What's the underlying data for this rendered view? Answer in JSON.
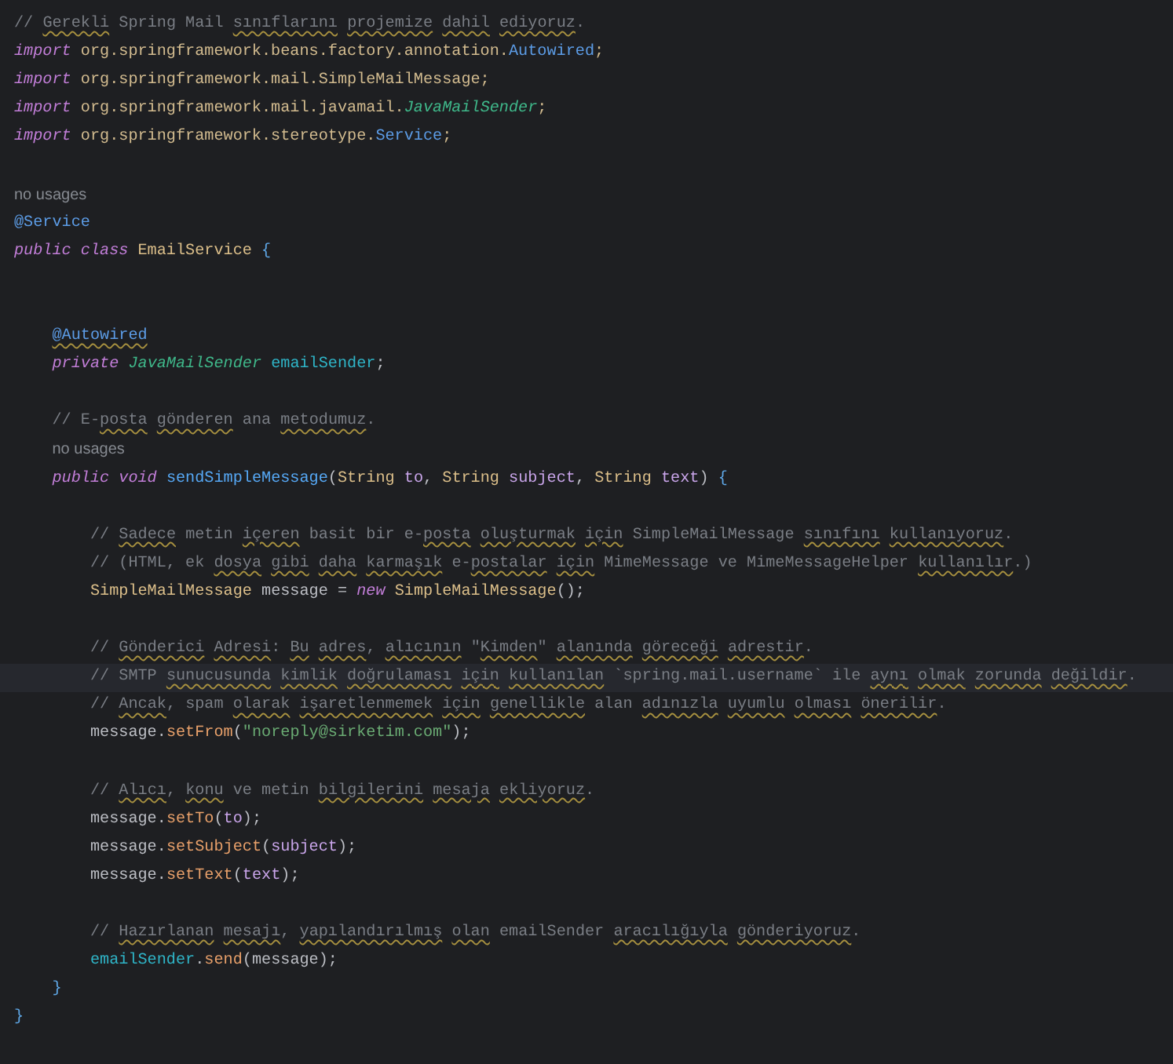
{
  "editor": {
    "lines": [
      {
        "kind": "code",
        "current": false,
        "tokens": [
          {
            "kind": "comment",
            "text": "// ",
            "typo": false
          },
          {
            "kind": "comment",
            "text": "Gerekli",
            "typo": true
          },
          {
            "kind": "comment",
            "text": " Spring Mail ",
            "typo": false
          },
          {
            "kind": "comment",
            "text": "sınıflarını ",
            "typo": true
          },
          {
            "kind": "comment",
            "text": "projemize ",
            "typo": true
          },
          {
            "kind": "comment",
            "text": "dahil ",
            "typo": true
          },
          {
            "kind": "comment",
            "text": "ediyoruz",
            "typo": true
          },
          {
            "kind": "comment",
            "text": ".",
            "typo": false
          }
        ]
      },
      {
        "kind": "code",
        "current": false,
        "tokens": [
          {
            "kind": "keyword",
            "text": "import"
          },
          {
            "kind": "package",
            "text": " org.springframework.beans.factory.annotation."
          },
          {
            "kind": "annotation",
            "text": "Autowired"
          },
          {
            "kind": "package",
            "text": ";"
          }
        ]
      },
      {
        "kind": "code",
        "current": false,
        "tokens": [
          {
            "kind": "keyword",
            "text": "import"
          },
          {
            "kind": "package",
            "text": " org.springframework.mail.SimpleMailMessage;"
          }
        ]
      },
      {
        "kind": "code",
        "current": false,
        "tokens": [
          {
            "kind": "keyword",
            "text": "import"
          },
          {
            "kind": "package",
            "text": " org.springframework.mail.javamail."
          },
          {
            "kind": "interface",
            "text": "JavaMailSender"
          },
          {
            "kind": "package",
            "text": ";"
          }
        ]
      },
      {
        "kind": "code",
        "current": false,
        "tokens": [
          {
            "kind": "keyword",
            "text": "import"
          },
          {
            "kind": "package",
            "text": " org.springframework.stereotype."
          },
          {
            "kind": "annotation",
            "text": "Service"
          },
          {
            "kind": "package",
            "text": ";"
          }
        ]
      },
      {
        "kind": "blank",
        "current": false
      },
      {
        "kind": "hint",
        "current": false,
        "tokens": [
          {
            "kind": "hint",
            "text": "no usages"
          }
        ]
      },
      {
        "kind": "code",
        "current": false,
        "tokens": [
          {
            "kind": "annotation",
            "text": "@Service"
          }
        ]
      },
      {
        "kind": "code",
        "current": false,
        "tokens": [
          {
            "kind": "keyword",
            "text": "public class"
          },
          {
            "kind": "type",
            "text": " EmailService "
          },
          {
            "kind": "brace",
            "text": "{"
          }
        ]
      },
      {
        "kind": "blank",
        "current": false
      },
      {
        "kind": "blank",
        "current": false
      },
      {
        "kind": "code",
        "current": false,
        "tokens": [
          {
            "kind": "annotation",
            "text": "    @Autowired",
            "typo": true
          }
        ]
      },
      {
        "kind": "code",
        "current": false,
        "tokens": [
          {
            "kind": "keyword",
            "text": "    private "
          },
          {
            "kind": "interface",
            "text": "JavaMailSender "
          },
          {
            "kind": "field",
            "text": "emailSender"
          },
          {
            "kind": "plain",
            "text": ";"
          }
        ]
      },
      {
        "kind": "blank",
        "current": false
      },
      {
        "kind": "code",
        "current": false,
        "tokens": [
          {
            "kind": "comment",
            "text": "    // E-",
            "typo": false
          },
          {
            "kind": "comment",
            "text": "posta ",
            "typo": true
          },
          {
            "kind": "comment",
            "text": "gönderen",
            "typo": true
          },
          {
            "kind": "comment",
            "text": " ana ",
            "typo": false
          },
          {
            "kind": "comment",
            "text": "metodumuz",
            "typo": true
          },
          {
            "kind": "comment",
            "text": ".",
            "typo": false
          }
        ]
      },
      {
        "kind": "hint",
        "current": false,
        "tokens": [
          {
            "kind": "hint",
            "text": "    no usages"
          }
        ]
      },
      {
        "kind": "code",
        "current": false,
        "tokens": [
          {
            "kind": "keyword",
            "text": "    public void "
          },
          {
            "kind": "method",
            "text": "sendSimpleMessage"
          },
          {
            "kind": "plain",
            "text": "("
          },
          {
            "kind": "type",
            "text": "String "
          },
          {
            "kind": "param",
            "text": "to"
          },
          {
            "kind": "plain",
            "text": ", "
          },
          {
            "kind": "type",
            "text": "String "
          },
          {
            "kind": "param",
            "text": "subject"
          },
          {
            "kind": "plain",
            "text": ", "
          },
          {
            "kind": "type",
            "text": "String "
          },
          {
            "kind": "param",
            "text": "text"
          },
          {
            "kind": "plain",
            "text": ") "
          },
          {
            "kind": "brace",
            "text": "{"
          }
        ]
      },
      {
        "kind": "blank",
        "current": false
      },
      {
        "kind": "code",
        "current": false,
        "tokens": [
          {
            "kind": "comment",
            "text": "        // ",
            "typo": false
          },
          {
            "kind": "comment",
            "text": "Sadece",
            "typo": true
          },
          {
            "kind": "comment",
            "text": " metin ",
            "typo": false
          },
          {
            "kind": "comment",
            "text": "içeren",
            "typo": true
          },
          {
            "kind": "comment",
            "text": " basit bir e-",
            "typo": false
          },
          {
            "kind": "comment",
            "text": "posta ",
            "typo": true
          },
          {
            "kind": "comment",
            "text": "oluşturmak ",
            "typo": true
          },
          {
            "kind": "comment",
            "text": "için",
            "typo": true
          },
          {
            "kind": "comment",
            "text": " SimpleMailMessage ",
            "typo": false
          },
          {
            "kind": "comment",
            "text": "sınıfını ",
            "typo": true
          },
          {
            "kind": "comment",
            "text": "kullanıyoruz",
            "typo": true
          },
          {
            "kind": "comment",
            "text": ".",
            "typo": false
          }
        ]
      },
      {
        "kind": "code",
        "current": false,
        "tokens": [
          {
            "kind": "comment",
            "text": "        // (HTML, ek ",
            "typo": false
          },
          {
            "kind": "comment",
            "text": "dosya ",
            "typo": true
          },
          {
            "kind": "comment",
            "text": "gibi ",
            "typo": true
          },
          {
            "kind": "comment",
            "text": "daha ",
            "typo": true
          },
          {
            "kind": "comment",
            "text": "karmaşık",
            "typo": true
          },
          {
            "kind": "comment",
            "text": " e-",
            "typo": false
          },
          {
            "kind": "comment",
            "text": "postalar ",
            "typo": true
          },
          {
            "kind": "comment",
            "text": "için",
            "typo": true
          },
          {
            "kind": "comment",
            "text": " MimeMessage ve MimeMessageHelper ",
            "typo": false
          },
          {
            "kind": "comment",
            "text": "kullanılır",
            "typo": true
          },
          {
            "kind": "comment",
            "text": ".)",
            "typo": false
          }
        ]
      },
      {
        "kind": "code",
        "current": false,
        "tokens": [
          {
            "kind": "type",
            "text": "        SimpleMailMessage"
          },
          {
            "kind": "plain",
            "text": " message = "
          },
          {
            "kind": "keyword",
            "text": "new "
          },
          {
            "kind": "type",
            "text": "SimpleMailMessage"
          },
          {
            "kind": "plain",
            "text": "();"
          }
        ]
      },
      {
        "kind": "blank",
        "current": false
      },
      {
        "kind": "code",
        "current": false,
        "tokens": [
          {
            "kind": "comment",
            "text": "        // ",
            "typo": false
          },
          {
            "kind": "comment",
            "text": "Gönderici ",
            "typo": true
          },
          {
            "kind": "comment",
            "text": "Adresi",
            "typo": true
          },
          {
            "kind": "comment",
            "text": ": ",
            "typo": false
          },
          {
            "kind": "comment",
            "text": "Bu ",
            "typo": true
          },
          {
            "kind": "comment",
            "text": "adres",
            "typo": true
          },
          {
            "kind": "comment",
            "text": ", ",
            "typo": false
          },
          {
            "kind": "comment",
            "text": "alıcının",
            "typo": true
          },
          {
            "kind": "comment",
            "text": " \"",
            "typo": false
          },
          {
            "kind": "comment",
            "text": "Kimden",
            "typo": true
          },
          {
            "kind": "comment",
            "text": "\" ",
            "typo": false
          },
          {
            "kind": "comment",
            "text": "alanında ",
            "typo": true
          },
          {
            "kind": "comment",
            "text": "göreceği ",
            "typo": true
          },
          {
            "kind": "comment",
            "text": "adrestir",
            "typo": true
          },
          {
            "kind": "comment",
            "text": ".",
            "typo": false
          }
        ]
      },
      {
        "kind": "code",
        "current": true,
        "tokens": [
          {
            "kind": "comment",
            "text": "        // SMTP ",
            "typo": false
          },
          {
            "kind": "comment",
            "text": "sunucusunda ",
            "typo": true
          },
          {
            "kind": "comment",
            "text": "kimlik ",
            "typo": true
          },
          {
            "kind": "comment",
            "text": "doğrulaması ",
            "typo": true
          },
          {
            "kind": "comment",
            "text": "için ",
            "typo": true
          },
          {
            "kind": "comment",
            "text": "kullanılan",
            "typo": true
          },
          {
            "kind": "comment",
            "text": " `spring.mail.username` ile ",
            "typo": false
          },
          {
            "kind": "comment",
            "text": "aynı ",
            "typo": true
          },
          {
            "kind": "comment",
            "text": "olmak ",
            "typo": true
          },
          {
            "kind": "comment",
            "text": "zorunda ",
            "typo": true
          },
          {
            "kind": "comment",
            "text": "değildir",
            "typo": true
          },
          {
            "kind": "comment",
            "text": ".",
            "typo": false
          }
        ]
      },
      {
        "kind": "code",
        "current": false,
        "tokens": [
          {
            "kind": "comment",
            "text": "        // ",
            "typo": false
          },
          {
            "kind": "comment",
            "text": "Ancak",
            "typo": true
          },
          {
            "kind": "comment",
            "text": ", spam ",
            "typo": false
          },
          {
            "kind": "comment",
            "text": "olarak ",
            "typo": true
          },
          {
            "kind": "comment",
            "text": "işaretlenmemek ",
            "typo": true
          },
          {
            "kind": "comment",
            "text": "için ",
            "typo": true
          },
          {
            "kind": "comment",
            "text": "genellikle",
            "typo": true
          },
          {
            "kind": "comment",
            "text": " alan ",
            "typo": false
          },
          {
            "kind": "comment",
            "text": "adınızla ",
            "typo": true
          },
          {
            "kind": "comment",
            "text": "uyumlu ",
            "typo": true
          },
          {
            "kind": "comment",
            "text": "olması ",
            "typo": true
          },
          {
            "kind": "comment",
            "text": "önerilir",
            "typo": true
          },
          {
            "kind": "comment",
            "text": ".",
            "typo": false
          }
        ]
      },
      {
        "kind": "code",
        "current": false,
        "tokens": [
          {
            "kind": "plain",
            "text": "        message."
          },
          {
            "kind": "call",
            "text": "setFrom"
          },
          {
            "kind": "plain",
            "text": "("
          },
          {
            "kind": "string",
            "text": "\"noreply@sirketim.com\""
          },
          {
            "kind": "plain",
            "text": ");"
          }
        ]
      },
      {
        "kind": "blank",
        "current": false
      },
      {
        "kind": "code",
        "current": false,
        "tokens": [
          {
            "kind": "comment",
            "text": "        // ",
            "typo": false
          },
          {
            "kind": "comment",
            "text": "Alıcı",
            "typo": true
          },
          {
            "kind": "comment",
            "text": ", ",
            "typo": false
          },
          {
            "kind": "comment",
            "text": "konu",
            "typo": true
          },
          {
            "kind": "comment",
            "text": " ve metin ",
            "typo": false
          },
          {
            "kind": "comment",
            "text": "bilgilerini ",
            "typo": true
          },
          {
            "kind": "comment",
            "text": "mesaja ",
            "typo": true
          },
          {
            "kind": "comment",
            "text": "ekliyoruz",
            "typo": true
          },
          {
            "kind": "comment",
            "text": ".",
            "typo": false
          }
        ]
      },
      {
        "kind": "code",
        "current": false,
        "tokens": [
          {
            "kind": "plain",
            "text": "        message."
          },
          {
            "kind": "call",
            "text": "setTo"
          },
          {
            "kind": "plain",
            "text": "("
          },
          {
            "kind": "param",
            "text": "to"
          },
          {
            "kind": "plain",
            "text": ");"
          }
        ]
      },
      {
        "kind": "code",
        "current": false,
        "tokens": [
          {
            "kind": "plain",
            "text": "        message."
          },
          {
            "kind": "call",
            "text": "setSubject"
          },
          {
            "kind": "plain",
            "text": "("
          },
          {
            "kind": "param",
            "text": "subject"
          },
          {
            "kind": "plain",
            "text": ");"
          }
        ]
      },
      {
        "kind": "code",
        "current": false,
        "tokens": [
          {
            "kind": "plain",
            "text": "        message."
          },
          {
            "kind": "call",
            "text": "setText"
          },
          {
            "kind": "plain",
            "text": "("
          },
          {
            "kind": "param",
            "text": "text"
          },
          {
            "kind": "plain",
            "text": ");"
          }
        ]
      },
      {
        "kind": "blank",
        "current": false
      },
      {
        "kind": "code",
        "current": false,
        "tokens": [
          {
            "kind": "comment",
            "text": "        // ",
            "typo": false
          },
          {
            "kind": "comment",
            "text": "Hazırlanan ",
            "typo": true
          },
          {
            "kind": "comment",
            "text": "mesajı",
            "typo": true
          },
          {
            "kind": "comment",
            "text": ", ",
            "typo": false
          },
          {
            "kind": "comment",
            "text": "yapılandırılmış ",
            "typo": true
          },
          {
            "kind": "comment",
            "text": "olan",
            "typo": true
          },
          {
            "kind": "comment",
            "text": " emailSender ",
            "typo": false
          },
          {
            "kind": "comment",
            "text": "aracılığıyla ",
            "typo": true
          },
          {
            "kind": "comment",
            "text": "gönderiyoruz",
            "typo": true
          },
          {
            "kind": "comment",
            "text": ".",
            "typo": false
          }
        ]
      },
      {
        "kind": "code",
        "current": false,
        "tokens": [
          {
            "kind": "field",
            "text": "        emailSender"
          },
          {
            "kind": "plain",
            "text": "."
          },
          {
            "kind": "call",
            "text": "send"
          },
          {
            "kind": "plain",
            "text": "(message);"
          }
        ]
      },
      {
        "kind": "code",
        "current": false,
        "tokens": [
          {
            "kind": "brace",
            "text": "    }"
          }
        ]
      },
      {
        "kind": "code",
        "current": false,
        "tokens": [
          {
            "kind": "brace",
            "text": "}"
          }
        ]
      }
    ]
  }
}
